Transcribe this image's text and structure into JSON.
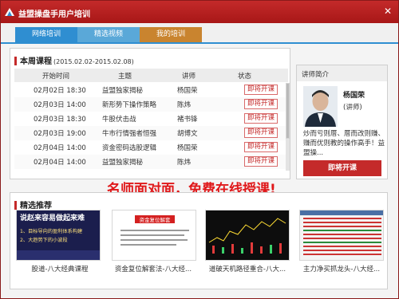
{
  "window": {
    "title": "益盟操盘手用户培训",
    "close_glyph": "✕"
  },
  "tabs": [
    {
      "label": "网络培训"
    },
    {
      "label": "精选视频"
    },
    {
      "label": "我的培训"
    }
  ],
  "week": {
    "title": "本周课程",
    "date_range": "(2015.02.02-2015.02.08)",
    "columns": [
      "开始时间",
      "主题",
      "讲师",
      "状态"
    ],
    "rows": [
      {
        "time": "02月02日 18:30",
        "topic": "益盟独家揭秘",
        "teacher": "杨国荣",
        "status": "即将开课"
      },
      {
        "time": "02月03日 14:00",
        "topic": "新形势下操作策略",
        "teacher": "陈炜",
        "status": "即将开课"
      },
      {
        "time": "02月03日 18:30",
        "topic": "牛股伏击战",
        "teacher": "褚书锋",
        "status": "即将开课"
      },
      {
        "time": "02月03日 19:00",
        "topic": "牛市行情强者恒强",
        "teacher": "胡博文",
        "status": "即将开课"
      },
      {
        "time": "02月04日 14:00",
        "topic": "资金密码选股逻辑",
        "teacher": "杨国荣",
        "status": "即将开课"
      },
      {
        "time": "02月04日 14:00",
        "topic": "益盟独家揭秘",
        "teacher": "陈炜",
        "status": "即将开课"
      }
    ]
  },
  "teacher": {
    "header": "讲师简介",
    "name": "杨国荣",
    "title": "(讲师)",
    "desc": "炒而亏则厝、厝而改则赚、赚而优则教的操作高手！益盟操...",
    "button": "即将开课"
  },
  "promo": "名师面对面，免费在线授课!",
  "recommend": {
    "title": "精选推荐",
    "items": [
      {
        "caption": "股道-八大经典课程",
        "thumb_line1": "说赵来容易做起来难",
        "thumb_line2": "1、目标导向的盈利体系构建",
        "thumb_line3": "2、大趋势下的小波段"
      },
      {
        "caption": "资金复位解套法-八大经...",
        "thumb_line1": "资金复位解套"
      },
      {
        "caption": "道破天机路径重合-八大...",
        "thumb_line1": ""
      },
      {
        "caption": "主力净买抓龙头-八大经...",
        "thumb_line1": ""
      }
    ]
  },
  "colors": {
    "brand_red": "#c42a2a",
    "tab_blue": "#2f8ed1",
    "tab_orange": "#c9842f",
    "promo_red": "#e0181a"
  }
}
